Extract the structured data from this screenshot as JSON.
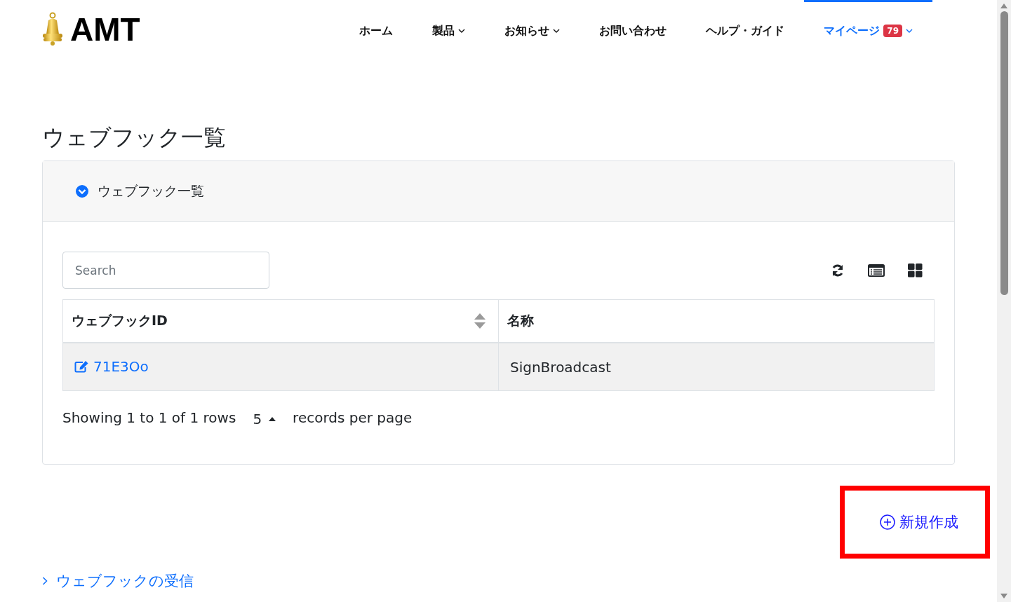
{
  "logo": {
    "text": "AMT"
  },
  "nav": [
    {
      "label": "ホーム",
      "has_menu": false,
      "selected": false
    },
    {
      "label": "製品",
      "has_menu": true,
      "selected": false
    },
    {
      "label": "お知らせ",
      "has_menu": true,
      "selected": false
    },
    {
      "label": "お問い合わせ",
      "has_menu": false,
      "selected": false
    },
    {
      "label": "ヘルプ・ガイド",
      "has_menu": false,
      "selected": false
    },
    {
      "label": "マイページ",
      "has_menu": true,
      "selected": true,
      "badge": "79"
    }
  ],
  "page_title": "ウェブフック一覧",
  "panel": {
    "title": "ウェブフック一覧",
    "expanded": true
  },
  "search": {
    "placeholder": "Search"
  },
  "table": {
    "columns": [
      {
        "label": "ウェブフックID",
        "sortable": true
      },
      {
        "label": "名称",
        "sortable": false
      }
    ],
    "rows": [
      {
        "id": "71E3Oo",
        "name": "SignBroadcast",
        "selected": true
      }
    ]
  },
  "pagination": {
    "summary": "Showing 1 to 1 of 1 rows",
    "page_size": "5",
    "suffix": "records per page"
  },
  "create_button": {
    "label": "新規作成",
    "highlighted": true
  },
  "footer_link": {
    "label": "ウェブフックの受信"
  }
}
